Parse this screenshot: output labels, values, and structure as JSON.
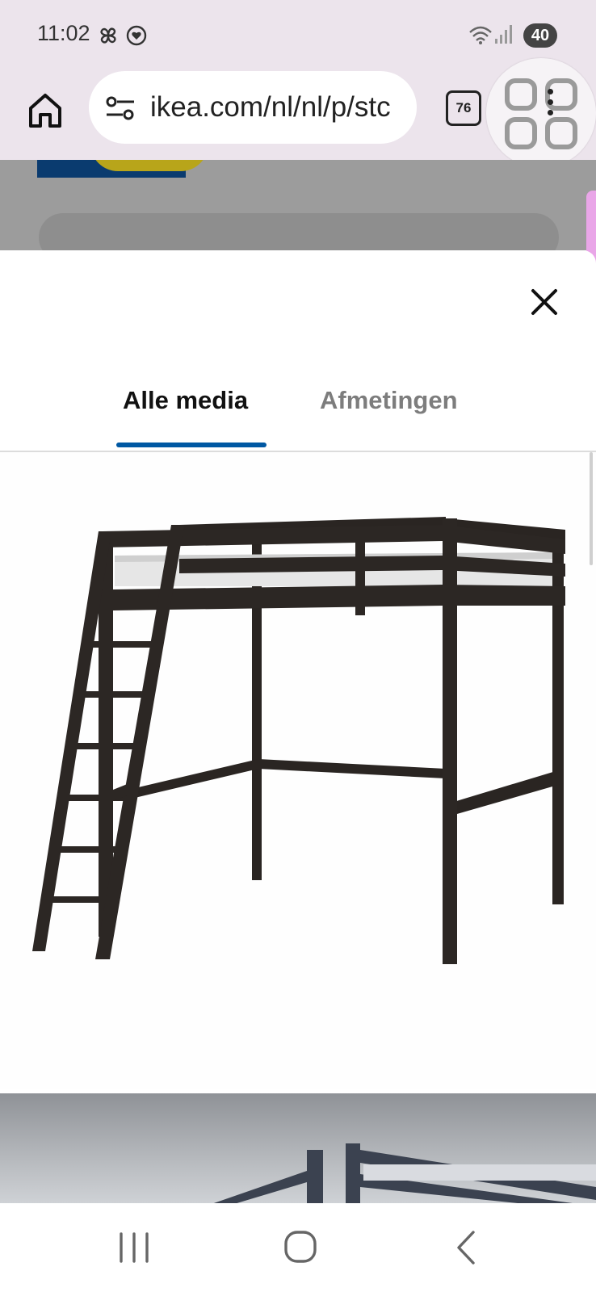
{
  "status_bar": {
    "time": "11:02",
    "battery": "40",
    "icons": [
      "pinwheel-icon",
      "heart-shield-icon",
      "wifi-icon",
      "signal-icon"
    ]
  },
  "browser": {
    "url": "ikea.com/nl/nl/p/stc",
    "tab_count": "76",
    "icons": [
      "home-icon",
      "site-settings-icon",
      "more-vert-icon",
      "apps-grid-icon"
    ]
  },
  "modal": {
    "close_icon": "close-icon",
    "tabs": [
      {
        "label": "Alle media",
        "active": true
      },
      {
        "label": "Afmetingen",
        "active": false
      }
    ],
    "accent_color": "#0058a3"
  },
  "nav_bar": {
    "buttons": [
      "recent-apps-icon",
      "home-circle-icon",
      "back-icon"
    ]
  }
}
